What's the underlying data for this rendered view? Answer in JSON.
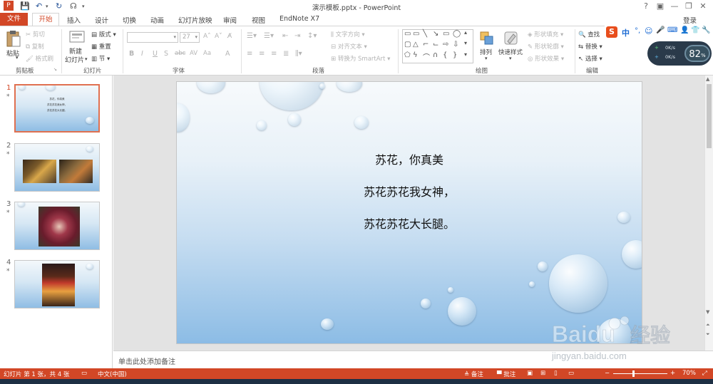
{
  "window": {
    "title": "演示模板.pptx - PowerPoint"
  },
  "tabs": {
    "file": "文件",
    "items": [
      "开始",
      "插入",
      "设计",
      "切换",
      "动画",
      "幻灯片放映",
      "审阅",
      "视图",
      "EndNote X7"
    ],
    "login": "登录"
  },
  "ribbon": {
    "clipboard": {
      "paste": "粘贴",
      "cut": "剪切",
      "copy": "复制",
      "format_painter": "格式刷",
      "label": "剪贴板"
    },
    "slides": {
      "new_slide": "新建",
      "new_slide2": "幻灯片",
      "layout": "版式",
      "reset": "重置",
      "section": "节",
      "label": "幻灯片"
    },
    "font": {
      "font_size": "27",
      "label": "字体",
      "buttons": [
        "B",
        "I",
        "U",
        "S",
        "abc",
        "AV",
        "Aa",
        "A"
      ]
    },
    "paragraph": {
      "text_direction": "文字方向",
      "align_text": "对齐文本",
      "smartart": "转换为 SmartArt",
      "label": "段落"
    },
    "drawing": {
      "arrange": "排列",
      "quick_styles": "快速样式",
      "shape_fill": "形状填充",
      "shape_outline": "形状轮廓",
      "shape_effects": "形状效果",
      "label": "绘图"
    },
    "editing": {
      "find": "查找",
      "replace": "替换",
      "select": "选择",
      "label": "编辑"
    }
  },
  "ime_bar": {
    "chars": [
      "中",
      "°,",
      "☺",
      "🎤",
      "⌨"
    ]
  },
  "net_widget": {
    "up": "0K/s",
    "down": "0K/s",
    "cpu": "82",
    "cpu_unit": "%"
  },
  "thumbnails": [
    {
      "num": "1",
      "star": "*",
      "lines": [
        "苏花，你真美",
        "苏花苏花我女神，",
        "苏花苏花大长腿。"
      ]
    },
    {
      "num": "2",
      "star": "*"
    },
    {
      "num": "3",
      "star": "*"
    },
    {
      "num": "4",
      "star": "*"
    }
  ],
  "slide": {
    "lines": [
      "苏花，你真美",
      "苏花苏花我女神，",
      "苏花苏花大长腿。"
    ]
  },
  "notes": {
    "placeholder": "单击此处添加备注"
  },
  "statusbar": {
    "slide_info": "幻灯片 第 1 张，共 4 张",
    "language": "中文(中国)",
    "notes": "备注",
    "comments": "批注",
    "zoom": "70%"
  },
  "watermark": {
    "brand": "Baidu",
    "brand_cn": "经验",
    "url": "jingyan.baidu.com"
  },
  "colors": {
    "accent": "#d24726",
    "slide_top": "#f7fafc",
    "slide_bottom": "#8cbce5"
  }
}
